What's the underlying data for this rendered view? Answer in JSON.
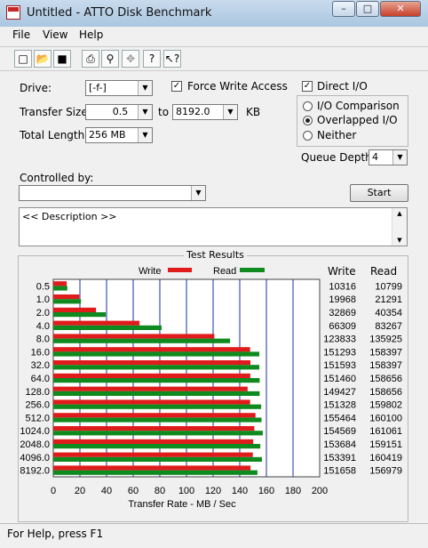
{
  "window": {
    "title": "Untitled - ATTO Disk Benchmark"
  },
  "menu": [
    "File",
    "View",
    "Help"
  ],
  "toolbar_icons": [
    "new-icon",
    "open-icon",
    "save-icon",
    "print-icon",
    "print-preview-icon",
    "move-icon",
    "help-icon",
    "context-help-icon"
  ],
  "settings": {
    "drive_label": "Drive:",
    "drive_value": "[-f-]",
    "force_write_label": "Force Write Access",
    "force_write_checked": true,
    "direct_io_label": "Direct I/O",
    "direct_io_checked": true,
    "transfer_size_label": "Transfer Size:",
    "transfer_from": "0.5",
    "to_label": "to",
    "transfer_to": "8192.0",
    "kb_label": "KB",
    "total_length_label": "Total Length:",
    "total_length_value": "256 MB",
    "io_options": [
      "I/O Comparison",
      "Overlapped I/O",
      "Neither"
    ],
    "io_selected": "Overlapped I/O",
    "queue_depth_label": "Queue Depth:",
    "queue_depth_value": "4",
    "controlled_by_label": "Controlled by:",
    "controlled_by_value": "",
    "start_label": "Start",
    "description_text": "<< Description >>"
  },
  "results": {
    "group_title": "Test Results",
    "write_header": "Write",
    "read_header": "Read"
  },
  "chart_data": {
    "type": "bar",
    "orientation": "horizontal",
    "categories": [
      "0.5",
      "1.0",
      "2.0",
      "4.0",
      "8.0",
      "16.0",
      "32.0",
      "64.0",
      "128.0",
      "256.0",
      "512.0",
      "1024.0",
      "2048.0",
      "4096.0",
      "8192.0"
    ],
    "series": [
      {
        "name": "Write",
        "color": "#e01b1b",
        "values": [
          10316,
          19968,
          32869,
          66309,
          123833,
          151293,
          151593,
          151460,
          149427,
          151328,
          155464,
          154569,
          153684,
          153391,
          151658
        ]
      },
      {
        "name": "Read",
        "color": "#0f8a1e",
        "values": [
          10799,
          21291,
          40354,
          83267,
          135925,
          158397,
          158397,
          158656,
          158656,
          159802,
          160100,
          161061,
          159151,
          160419,
          156979
        ]
      }
    ],
    "value_units": "KB/s",
    "xlabel": "Transfer Rate - MB / Sec",
    "xlim": [
      0,
      200
    ],
    "xticks": [
      0,
      20,
      40,
      60,
      80,
      100,
      120,
      140,
      160,
      180,
      200
    ],
    "legend_position": "top",
    "grid": true
  },
  "status": {
    "text": "For Help, press F1"
  }
}
